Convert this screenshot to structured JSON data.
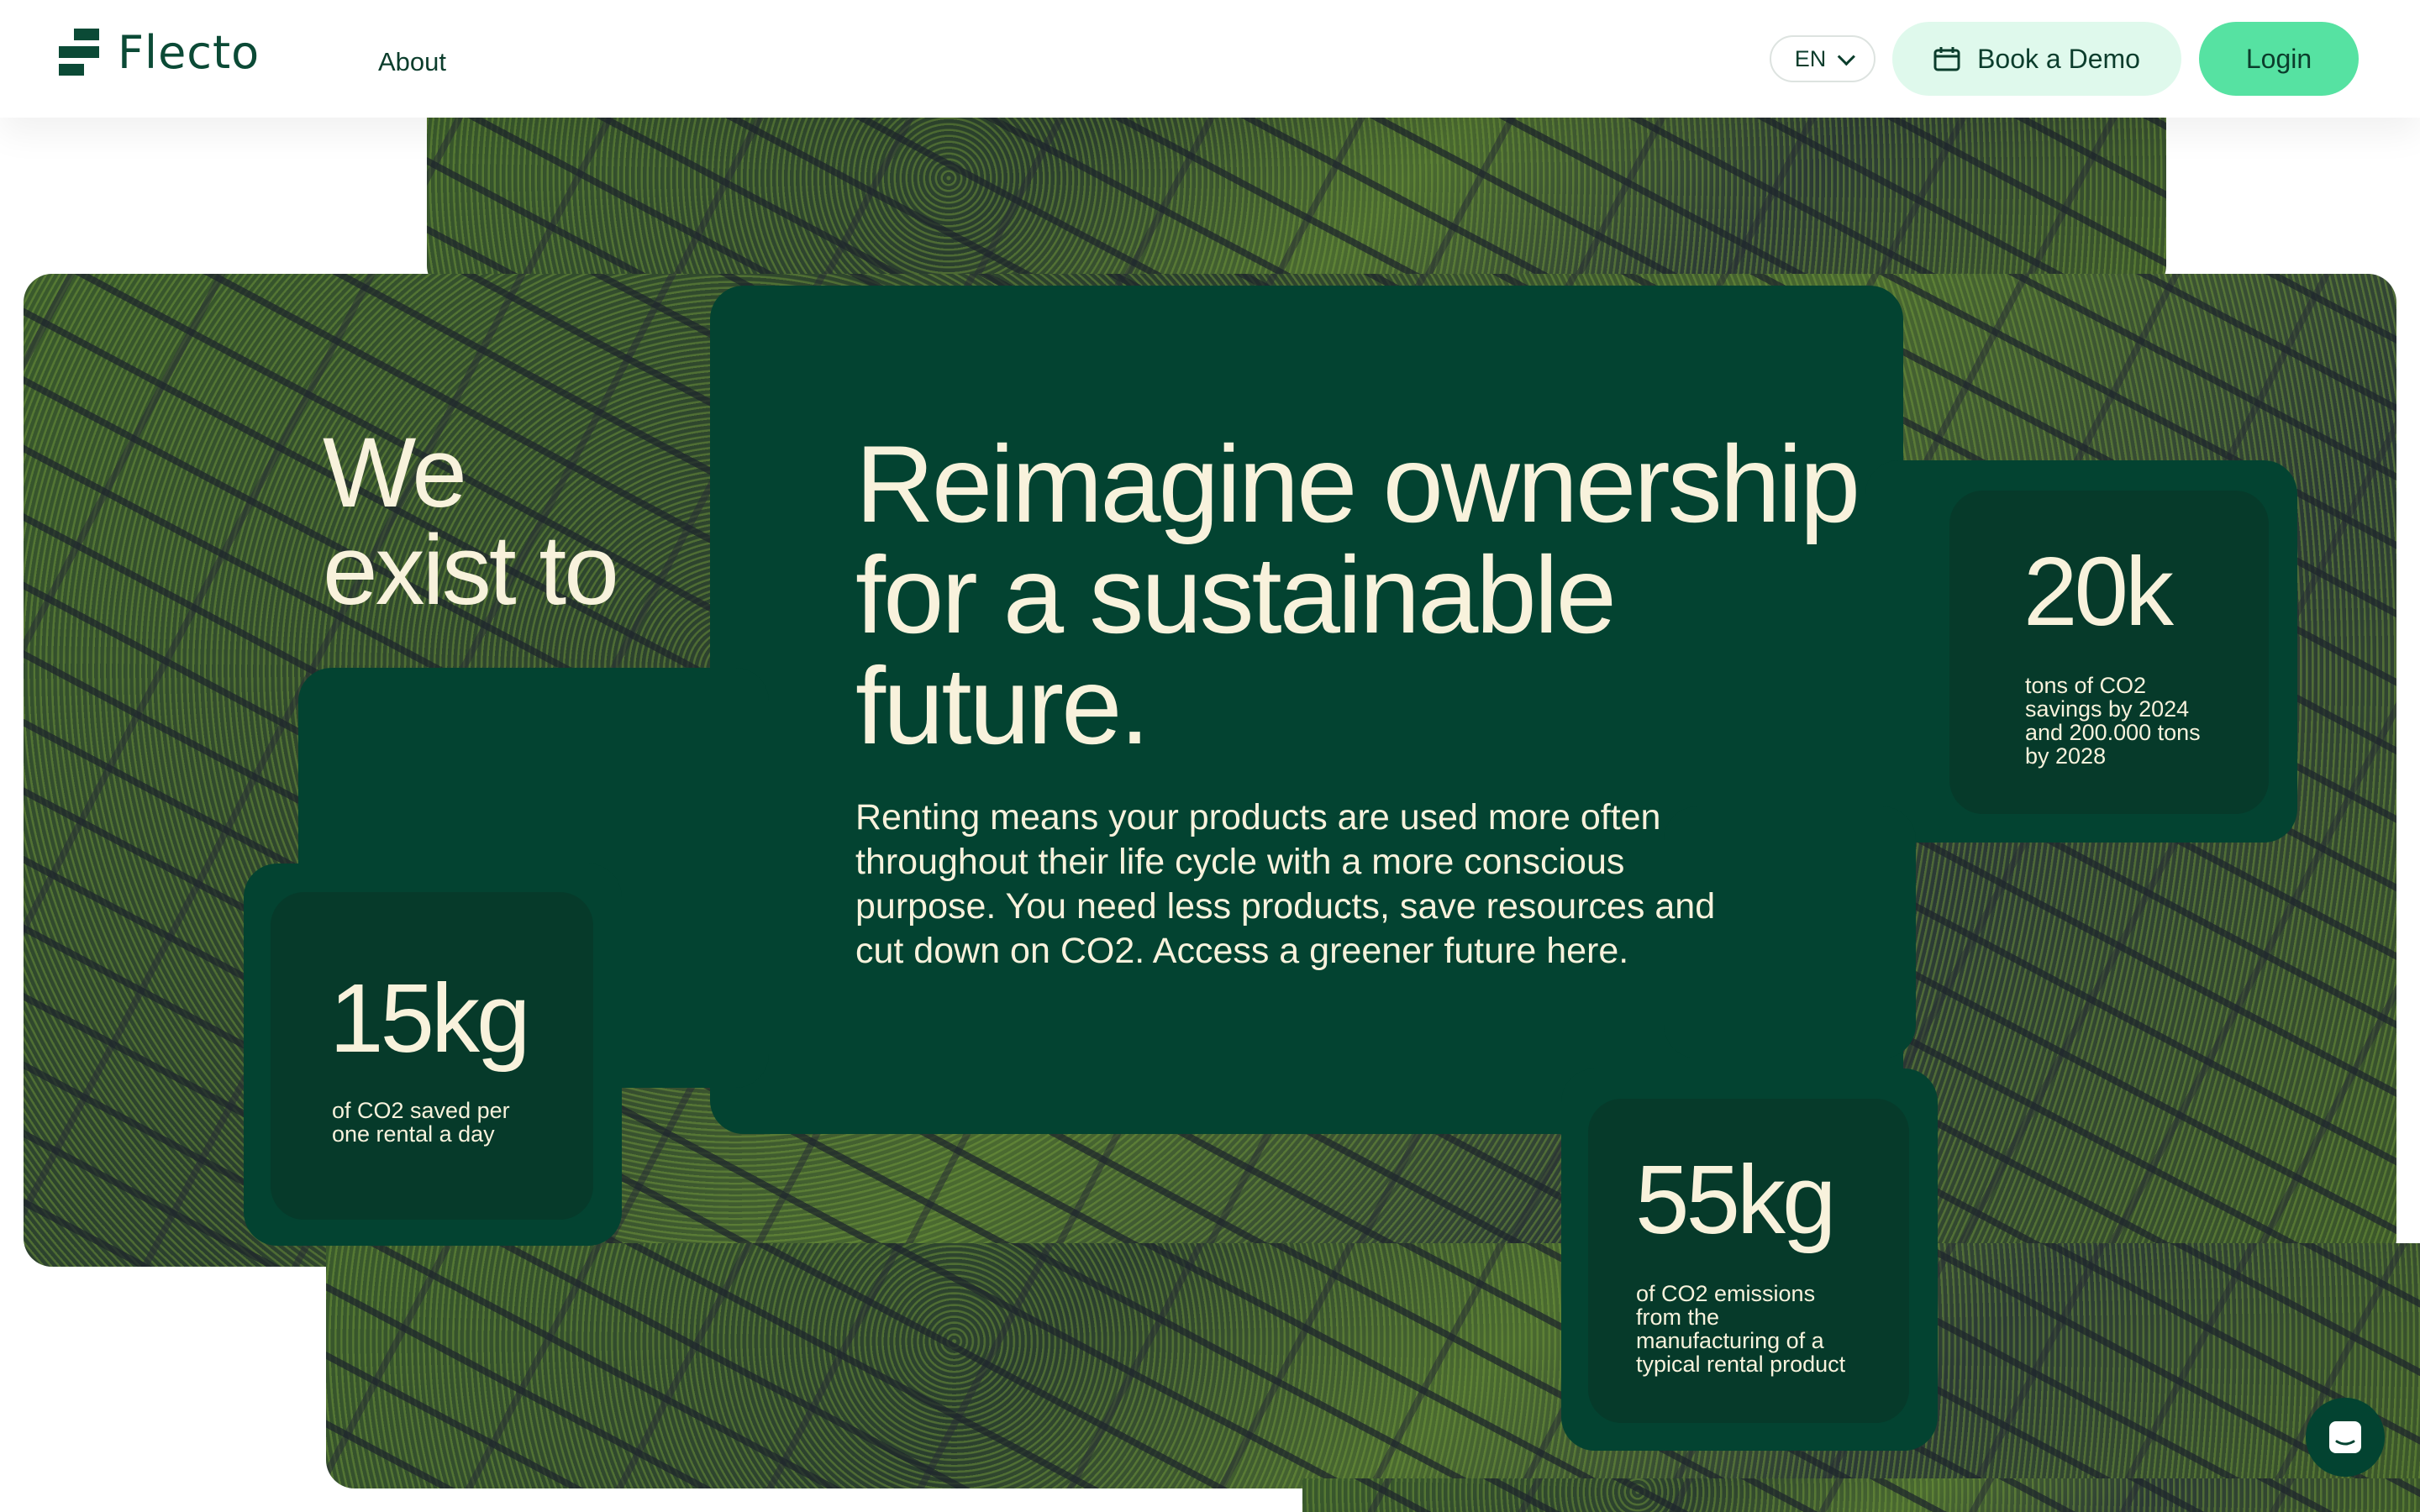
{
  "header": {
    "logo_text": "Flecto",
    "nav": {
      "about": "About"
    },
    "language": "EN",
    "book_demo": "Book a Demo",
    "login": "Login"
  },
  "hero": {
    "tagline_line1": "We",
    "tagline_line2": "exist to",
    "headline_line1": "Reimagine ownership",
    "headline_line2": "for a sustainable",
    "headline_line3": "future.",
    "body": "Renting means your products are used more often throughout their life cycle with a more conscious purpose. You need less products, save resources and cut down on CO2. Access a greener future here."
  },
  "stats": [
    {
      "value": "20k",
      "desc": "tons of CO2 savings by 2024 and 200.000 tons by 2028"
    },
    {
      "value": "15kg",
      "desc": "of CO2 saved per one rental a day"
    },
    {
      "value": "55kg",
      "desc": "of CO2 emissions from the manufacturing of a typical rental product"
    }
  ],
  "icons": {
    "logo": "flecto-logo-icon",
    "language": "chevron-down-icon",
    "demo": "calendar-icon",
    "chat": "chat-icon"
  },
  "colors": {
    "brand_dark_green": "#034331",
    "card_green": "#063a2a",
    "accent_mint": "#56e2a2",
    "mint_light": "#dff9ec",
    "cream_text": "#f8f2dc"
  }
}
